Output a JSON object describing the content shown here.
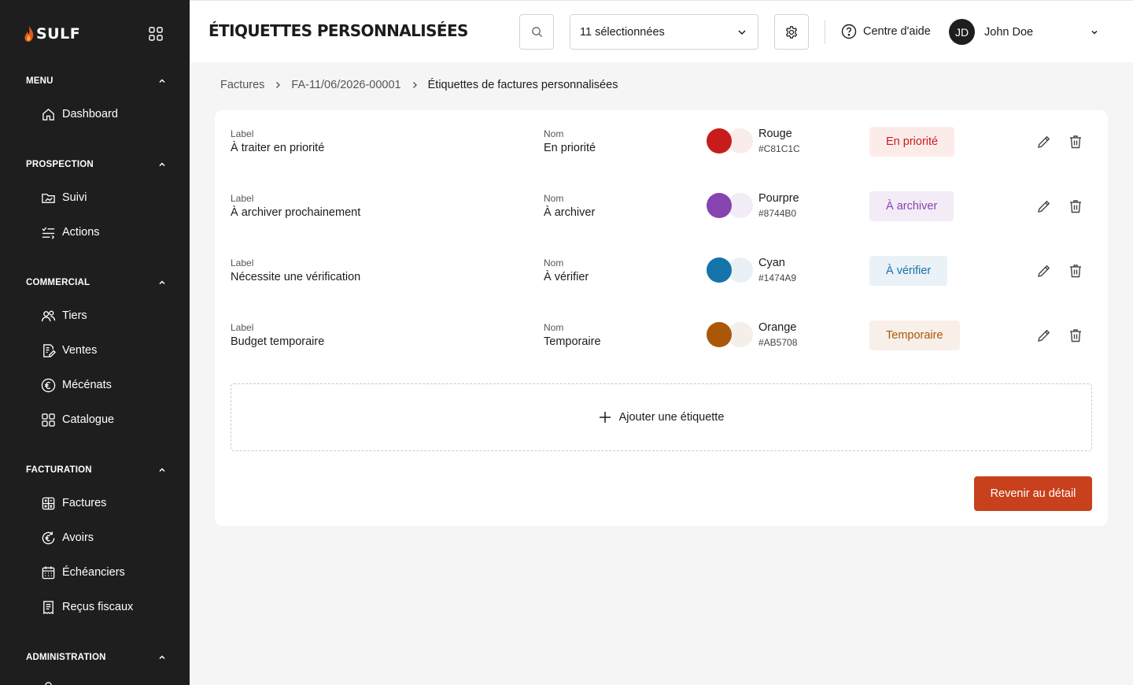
{
  "sidebar": {
    "logo": "SULF",
    "sections": [
      {
        "title": "MENU",
        "items": [
          {
            "label": "Dashboard",
            "icon": "home-icon"
          }
        ]
      },
      {
        "title": "PROSPECTION",
        "items": [
          {
            "label": "Suivi",
            "icon": "folder-chart-icon"
          },
          {
            "label": "Actions",
            "icon": "tasks-icon"
          }
        ]
      },
      {
        "title": "COMMERCIAL",
        "items": [
          {
            "label": "Tiers",
            "icon": "users-icon"
          },
          {
            "label": "Ventes",
            "icon": "document-edit-icon"
          },
          {
            "label": "Mécénats",
            "icon": "euro-circle-icon"
          },
          {
            "label": "Catalogue",
            "icon": "grid-icon"
          }
        ]
      },
      {
        "title": "FACTURATION",
        "items": [
          {
            "label": "Factures",
            "icon": "calculator-icon"
          },
          {
            "label": "Avoirs",
            "icon": "euro-refund-icon"
          },
          {
            "label": "Échéanciers",
            "icon": "calendar-icon"
          },
          {
            "label": "Reçus fiscaux",
            "icon": "receipt-icon"
          }
        ]
      },
      {
        "title": "ADMINISTRATION",
        "items": []
      }
    ]
  },
  "header": {
    "title": "ÉTIQUETTES PERSONNALISÉES",
    "select_value": "11 sélectionnées",
    "help_label": "Centre d'aide",
    "user_initials": "JD",
    "user_name": "John Doe"
  },
  "breadcrumb": [
    "Factures",
    "FA-11/06/2026-00001",
    "Étiquettes de factures personnalisées"
  ],
  "labels_caption": "Label",
  "nom_caption": "Nom",
  "tags": [
    {
      "label": "À traiter en priorité",
      "nom": "En priorité",
      "color_name": "Rouge",
      "hex": "#C81C1C",
      "light": "#f9ecea",
      "tag_bg": "#fbecea",
      "tag_fg": "#c81c1c"
    },
    {
      "label": "À archiver prochainement",
      "nom": "À archiver",
      "color_name": "Pourpre",
      "hex": "#8744B0",
      "light": "#f1ecf5",
      "tag_bg": "#f3ecf7",
      "tag_fg": "#8744b0"
    },
    {
      "label": "Nécessite une vérification",
      "nom": "À vérifier",
      "color_name": "Cyan",
      "hex": "#1474A9",
      "light": "#e9f0f5",
      "tag_bg": "#eaf1f7",
      "tag_fg": "#1474a9"
    },
    {
      "label": "Budget temporaire",
      "nom": "Temporaire",
      "color_name": "Orange",
      "hex": "#AB5708",
      "light": "#f5efea",
      "tag_bg": "#f7efe8",
      "tag_fg": "#ab5708"
    }
  ],
  "add_label": "Ajouter une étiquette",
  "back_label": "Revenir au détail",
  "colors": {
    "sidebar_bg": "#1e1e1e",
    "primary": "#c8401c"
  }
}
